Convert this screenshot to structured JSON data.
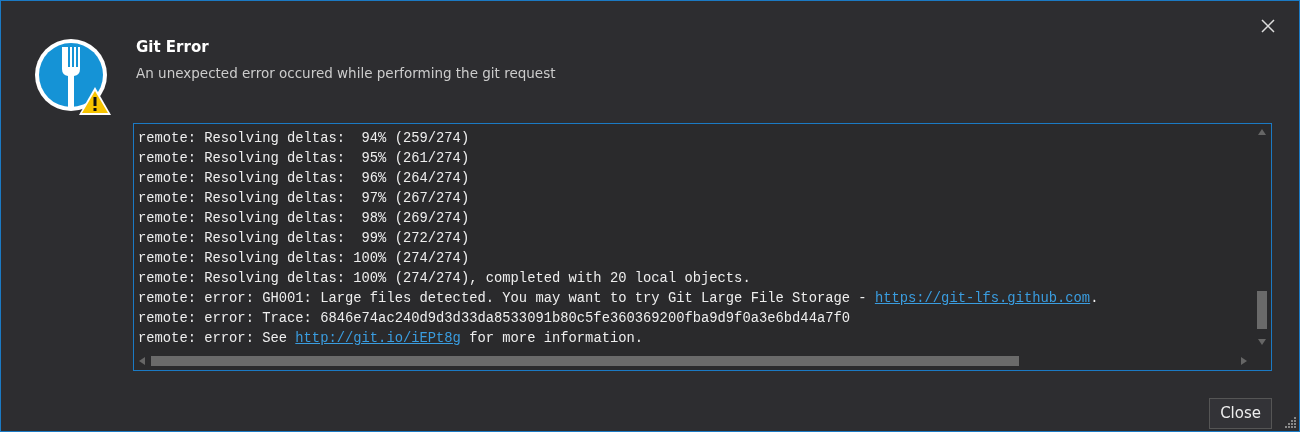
{
  "dialog": {
    "title": "Git Error",
    "message": "An unexpected error occured while performing the git request"
  },
  "log": [
    {
      "segments": [
        {
          "kind": "text",
          "text": "remote: Resolving deltas:  94% (259/274)"
        }
      ]
    },
    {
      "segments": [
        {
          "kind": "text",
          "text": "remote: Resolving deltas:  95% (261/274)"
        }
      ]
    },
    {
      "segments": [
        {
          "kind": "text",
          "text": "remote: Resolving deltas:  96% (264/274)"
        }
      ]
    },
    {
      "segments": [
        {
          "kind": "text",
          "text": "remote: Resolving deltas:  97% (267/274)"
        }
      ]
    },
    {
      "segments": [
        {
          "kind": "text",
          "text": "remote: Resolving deltas:  98% (269/274)"
        }
      ]
    },
    {
      "segments": [
        {
          "kind": "text",
          "text": "remote: Resolving deltas:  99% (272/274)"
        }
      ]
    },
    {
      "segments": [
        {
          "kind": "text",
          "text": "remote: Resolving deltas: 100% (274/274)"
        }
      ]
    },
    {
      "segments": [
        {
          "kind": "text",
          "text": "remote: Resolving deltas: 100% (274/274), completed with 20 local objects."
        }
      ]
    },
    {
      "segments": [
        {
          "kind": "text",
          "text": "remote: error: GH001: Large files detected. You may want to try Git Large File Storage - "
        },
        {
          "kind": "link",
          "text": "https://git-lfs.github.com"
        },
        {
          "kind": "text",
          "text": "."
        }
      ]
    },
    {
      "segments": [
        {
          "kind": "text",
          "text": "remote: error: Trace: 6846e74ac240d9d3d33da8533091b80c5fe360369200fba9d9f0a3e6bd44a7f0"
        }
      ]
    },
    {
      "segments": [
        {
          "kind": "text",
          "text": "remote: error: See "
        },
        {
          "kind": "link",
          "text": "http://git.io/iEPt8g"
        },
        {
          "kind": "text",
          "text": " for more information."
        }
      ]
    }
  ],
  "buttons": [
    "Close"
  ]
}
